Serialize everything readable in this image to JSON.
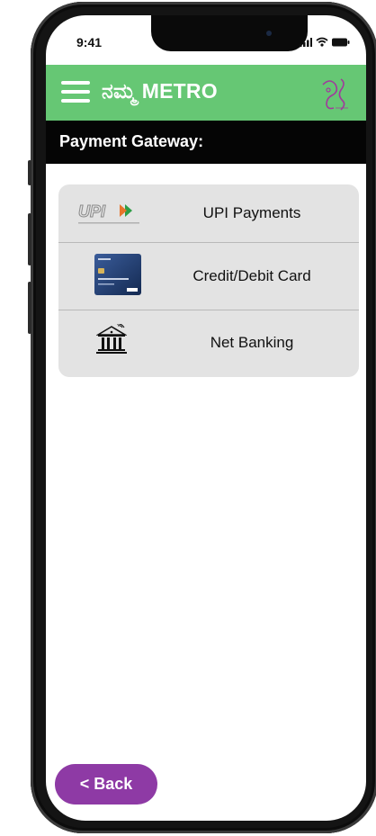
{
  "status_bar": {
    "time": "9:41"
  },
  "app_bar": {
    "title": "ನಮ್ಮ METRO"
  },
  "section": {
    "title": "Payment Gateway:"
  },
  "payment_options": [
    {
      "label": "UPI Payments",
      "icon": "upi-logo-icon"
    },
    {
      "label": "Credit/Debit Card",
      "icon": "credit-card-icon"
    },
    {
      "label": "Net Banking",
      "icon": "bank-icon"
    }
  ],
  "back_button": {
    "label": "< Back"
  },
  "colors": {
    "app_bar": "#66c774",
    "section_bar": "#050505",
    "card_bg": "#e3e3e3",
    "back_button": "#8e3aa5"
  }
}
